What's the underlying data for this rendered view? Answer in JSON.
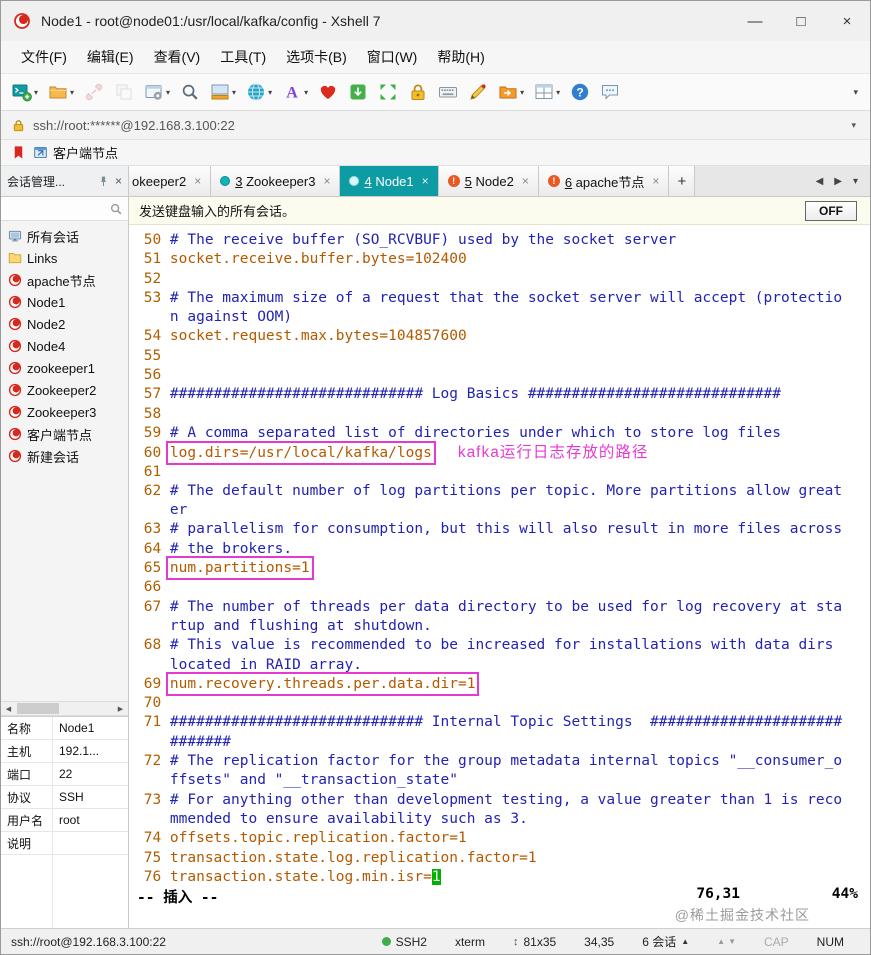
{
  "window": {
    "title": "Node1 - root@node01:/usr/local/kafka/config - Xshell 7",
    "minimize": "—",
    "maximize": "□",
    "close": "×"
  },
  "glyphs": {
    "close": "×",
    "dropdown": "▾",
    "left": "◀",
    "right": "▶",
    "up": "▲",
    "down": "▼",
    "resize": "↕"
  },
  "menu": [
    {
      "name": "menu-file",
      "label": "文件(F)"
    },
    {
      "name": "menu-edit",
      "label": "编辑(E)"
    },
    {
      "name": "menu-view",
      "label": "查看(V)"
    },
    {
      "name": "menu-tools",
      "label": "工具(T)"
    },
    {
      "name": "menu-tabs",
      "label": "选项卡(B)"
    },
    {
      "name": "menu-window",
      "label": "窗口(W)"
    },
    {
      "name": "menu-help",
      "label": "帮助(H)"
    }
  ],
  "toolbar": [
    {
      "name": "new-session-icon",
      "icon": "newterm",
      "dropdown": true
    },
    {
      "name": "open-session-icon",
      "icon": "openfolder",
      "dropdown": true
    },
    {
      "name": "disconnect-icon",
      "icon": "disconnect",
      "disabled": true
    },
    {
      "name": "duplicate-session-icon",
      "icon": "duplicate",
      "disabled": true
    },
    {
      "name": "properties-icon",
      "icon": "properties",
      "dropdown": true
    },
    {
      "name": "find-icon",
      "icon": "find"
    },
    {
      "name": "compose-bar-icon",
      "icon": "compose",
      "dropdown": true
    },
    {
      "name": "web-icon",
      "icon": "globe",
      "dropdown": true
    },
    {
      "name": "font-icon",
      "icon": "font",
      "dropdown": true
    },
    {
      "name": "zmodem-icon",
      "icon": "heart"
    },
    {
      "name": "transfer-icon",
      "icon": "greendoc"
    },
    {
      "name": "fullscreen-icon",
      "icon": "fullscreen"
    },
    {
      "name": "lock-screen-icon",
      "icon": "lock"
    },
    {
      "name": "virtual-keyboard-icon",
      "icon": "keyboard"
    },
    {
      "name": "highlight-icon",
      "icon": "pencil"
    },
    {
      "name": "receive-folder-icon",
      "icon": "folder2",
      "dropdown": true
    },
    {
      "name": "arrange-windows-icon",
      "icon": "layout",
      "dropdown": true
    },
    {
      "name": "help-icon",
      "icon": "help"
    },
    {
      "name": "feedback-icon",
      "icon": "bubble"
    }
  ],
  "address": {
    "url": "ssh://root:******@192.168.3.100:22"
  },
  "bookmarks": {
    "items": [
      {
        "label": "客户端节点"
      }
    ]
  },
  "tabbar": {
    "close_glyph": "×",
    "alert_glyph": "!",
    "new_tab": "+",
    "tabs": [
      {
        "name": "tab-zookeeper2-partial",
        "num": "",
        "label": "okeeper2",
        "icon": "none",
        "active": false,
        "clipped": true
      },
      {
        "name": "tab-zookeeper3",
        "num": "3",
        "label": "Zookeeper3",
        "icon": "ok",
        "active": false
      },
      {
        "name": "tab-node1",
        "num": "4",
        "label": "Node1",
        "icon": "ok",
        "active": true
      },
      {
        "name": "tab-node2",
        "num": "5",
        "label": "Node2",
        "icon": "alert",
        "active": false
      },
      {
        "name": "tab-apache-node",
        "num": "6",
        "label": "apache节点",
        "icon": "alert",
        "active": false
      }
    ]
  },
  "sidebar": {
    "title": "会话管理...",
    "tree": [
      {
        "name": "tree-item-all-sessions",
        "label": "所有会话",
        "icon": "computer"
      },
      {
        "name": "tree-item-links",
        "label": "Links",
        "icon": "folder"
      },
      {
        "name": "tree-item-apache-node",
        "label": "apache节点",
        "icon": "session"
      },
      {
        "name": "tree-item-node1",
        "label": "Node1",
        "icon": "session"
      },
      {
        "name": "tree-item-node2",
        "label": "Node2",
        "icon": "session"
      },
      {
        "name": "tree-item-node4",
        "label": "Node4",
        "icon": "session"
      },
      {
        "name": "tree-item-zookeeper1",
        "label": "zookeeper1",
        "icon": "session"
      },
      {
        "name": "tree-item-zookeeper2",
        "label": "Zookeeper2",
        "icon": "session"
      },
      {
        "name": "tree-item-zookeeper3",
        "label": "Zookeeper3",
        "icon": "session"
      },
      {
        "name": "tree-item-client-node",
        "label": "客户端节点",
        "icon": "session"
      },
      {
        "name": "tree-item-new-session",
        "label": "新建会话",
        "icon": "session"
      }
    ],
    "properties": [
      {
        "key": "名称",
        "value": "Node1"
      },
      {
        "key": "主机",
        "value": "192.1..."
      },
      {
        "key": "端口",
        "value": "22"
      },
      {
        "key": "协议",
        "value": "SSH"
      },
      {
        "key": "用户名",
        "value": "root"
      },
      {
        "key": "说明",
        "value": ""
      }
    ]
  },
  "broadcast": {
    "text": "发送键盘输入的所有会话。",
    "button": "OFF"
  },
  "terminal": {
    "mode": "-- 插入 --",
    "ruler_pos": "76,31",
    "ruler_pct": "44%",
    "watermark": "@稀土掘金技术社区",
    "lines": [
      {
        "n": "50",
        "s": [
          {
            "t": "# The receive buffer (SO_RCVBUF) used by the socket server",
            "c": "c"
          }
        ]
      },
      {
        "n": "51",
        "s": [
          {
            "t": "socket.receive.buffer.bytes=102400",
            "c": "p"
          }
        ]
      },
      {
        "n": "52",
        "s": []
      },
      {
        "n": "53",
        "s": [
          {
            "t": "# The maximum size of a request that the socket server will accept (protectio",
            "c": "c"
          }
        ]
      },
      {
        "n": "",
        "s": [
          {
            "t": "n against OOM)",
            "c": "c"
          }
        ]
      },
      {
        "n": "54",
        "s": [
          {
            "t": "socket.request.max.bytes=104857600",
            "c": "p"
          }
        ]
      },
      {
        "n": "55",
        "s": []
      },
      {
        "n": "56",
        "s": []
      },
      {
        "n": "57",
        "s": [
          {
            "t": "############################# Log Basics #############################",
            "c": "c"
          }
        ]
      },
      {
        "n": "58",
        "s": []
      },
      {
        "n": "59",
        "s": [
          {
            "t": "# A comma separated list of directories under which to store log files",
            "c": "c"
          }
        ]
      },
      {
        "n": "60",
        "s": [
          {
            "t": "log.dirs=/usr/local/kafka/logs",
            "c": "p",
            "box": true
          },
          {
            "t": "kafka运行日志存放的路径",
            "c": "note"
          }
        ]
      },
      {
        "n": "61",
        "s": []
      },
      {
        "n": "62",
        "s": [
          {
            "t": "# The default number of log partitions per topic. More partitions allow great",
            "c": "c"
          }
        ]
      },
      {
        "n": "",
        "s": [
          {
            "t": "er",
            "c": "c"
          }
        ]
      },
      {
        "n": "63",
        "s": [
          {
            "t": "# parallelism for consumption, but this will also result in more files across",
            "c": "c"
          }
        ]
      },
      {
        "n": "64",
        "s": [
          {
            "t": "# the brokers.",
            "c": "c"
          }
        ]
      },
      {
        "n": "65",
        "s": [
          {
            "t": "num.partitions=1",
            "c": "p",
            "box": true
          }
        ]
      },
      {
        "n": "66",
        "s": []
      },
      {
        "n": "67",
        "s": [
          {
            "t": "# The number of threads per data directory to be used for log recovery at sta",
            "c": "c"
          }
        ]
      },
      {
        "n": "",
        "s": [
          {
            "t": "rtup and flushing at shutdown.",
            "c": "c"
          }
        ]
      },
      {
        "n": "68",
        "s": [
          {
            "t": "# This value is recommended to be increased for installations with data dirs",
            "c": "c"
          }
        ]
      },
      {
        "n": "",
        "s": [
          {
            "t": "located in RAID array.",
            "c": "c"
          }
        ]
      },
      {
        "n": "69",
        "s": [
          {
            "t": "num.recovery.threads.per.data.dir=1",
            "c": "p",
            "box": true
          }
        ]
      },
      {
        "n": "70",
        "s": []
      },
      {
        "n": "71",
        "s": [
          {
            "t": "############################# Internal Topic Settings  ######################",
            "c": "c"
          }
        ]
      },
      {
        "n": "",
        "s": [
          {
            "t": "#######",
            "c": "c"
          }
        ]
      },
      {
        "n": "72",
        "s": [
          {
            "t": "# The replication factor for the group metadata internal topics \"__consumer_o",
            "c": "c"
          }
        ]
      },
      {
        "n": "",
        "s": [
          {
            "t": "ffsets\" and \"__transaction_state\"",
            "c": "c"
          }
        ]
      },
      {
        "n": "73",
        "s": [
          {
            "t": "# For anything other than development testing, a value greater than 1 is reco",
            "c": "c"
          }
        ]
      },
      {
        "n": "",
        "s": [
          {
            "t": "mmended to ensure availability such as 3.",
            "c": "c"
          }
        ]
      },
      {
        "n": "74",
        "s": [
          {
            "t": "offsets.topic.replication.factor=1",
            "c": "p"
          }
        ]
      },
      {
        "n": "75",
        "s": [
          {
            "t": "transaction.state.log.replication.factor=1",
            "c": "p"
          }
        ]
      },
      {
        "n": "76",
        "s": [
          {
            "t": "transaction.state.log.min.isr=",
            "c": "p"
          },
          {
            "t": "1",
            "c": "p",
            "cursor": true
          }
        ]
      }
    ]
  },
  "statusbar": {
    "url": "ssh://root@192.168.3.100:22",
    "protocol": "SSH2",
    "termtype": "xterm",
    "size": "81x35",
    "cursor": "34,35",
    "sessions": "6 会话",
    "cap": "CAP",
    "num": "NUM"
  },
  "colors": {
    "accent_teal": "#0d9ba4",
    "comment": "#2323b3",
    "property": "#b35a00",
    "linenr": "#af5f00",
    "highlight": "#e53ad2",
    "cursor_green": "#00b200",
    "session_red": "#d6281e"
  }
}
